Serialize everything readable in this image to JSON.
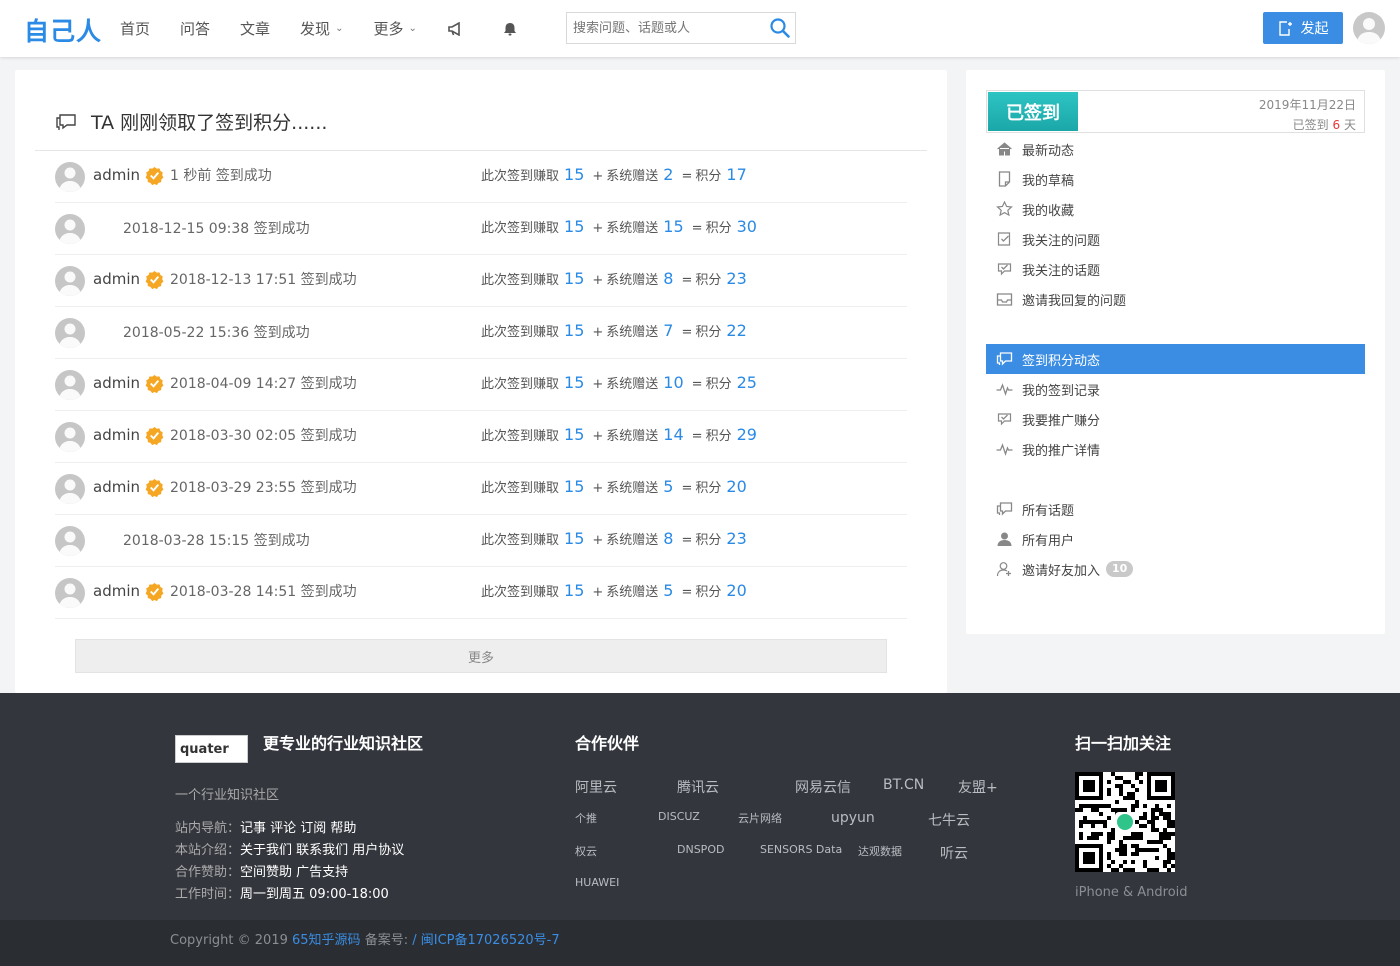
{
  "header": {
    "logo": "自己人",
    "nav": [
      {
        "label": "首页"
      },
      {
        "label": "问答"
      },
      {
        "label": "文章"
      },
      {
        "label": "发现",
        "dropdown": true
      },
      {
        "label": "更多",
        "dropdown": true
      }
    ],
    "nav_icons": [
      "megaphone-icon",
      "bell-icon"
    ],
    "search": {
      "placeholder": "搜索问题、话题或人"
    },
    "post_button": "发起"
  },
  "main": {
    "title": "TA 刚刚领取了签到积分......",
    "calc_labels": {
      "earned": "此次签到赚取",
      "plus": "+",
      "bonus": "系统赠送",
      "equals": "=",
      "total": "积分"
    },
    "rows": [
      {
        "user": "admin",
        "verified": true,
        "time": "1 秒前 签到成功",
        "earned": "15",
        "bonus": "2",
        "total": "17"
      },
      {
        "user": "",
        "verified": false,
        "time": "2018-12-15 09:38 签到成功",
        "earned": "15",
        "bonus": "15",
        "total": "30"
      },
      {
        "user": "admin",
        "verified": true,
        "time": "2018-12-13 17:51 签到成功",
        "earned": "15",
        "bonus": "8",
        "total": "23"
      },
      {
        "user": "",
        "verified": false,
        "time": "2018-05-22 15:36 签到成功",
        "earned": "15",
        "bonus": "7",
        "total": "22"
      },
      {
        "user": "admin",
        "verified": true,
        "time": "2018-04-09 14:27 签到成功",
        "earned": "15",
        "bonus": "10",
        "total": "25"
      },
      {
        "user": "admin",
        "verified": true,
        "time": "2018-03-30 02:05 签到成功",
        "earned": "15",
        "bonus": "14",
        "total": "29"
      },
      {
        "user": "admin",
        "verified": true,
        "time": "2018-03-29 23:55 签到成功",
        "earned": "15",
        "bonus": "5",
        "total": "20"
      },
      {
        "user": "",
        "verified": false,
        "time": "2018-03-28 15:15 签到成功",
        "earned": "15",
        "bonus": "8",
        "total": "23"
      },
      {
        "user": "admin",
        "verified": true,
        "time": "2018-03-28 14:51 签到成功",
        "earned": "15",
        "bonus": "5",
        "total": "20"
      }
    ],
    "more_label": "更多"
  },
  "sidebar": {
    "checkin": {
      "status": "已签到",
      "date": "2019年11月22日",
      "streak_prefix": "已签到",
      "streak_days": "6",
      "streak_suffix": "天"
    },
    "group1": [
      {
        "label": "最新动态",
        "icon": "home-icon"
      },
      {
        "label": "我的草稿",
        "icon": "draft-icon"
      },
      {
        "label": "我的收藏",
        "icon": "star-icon"
      },
      {
        "label": "我关注的问题",
        "icon": "check-doc-icon"
      },
      {
        "label": "我关注的话题",
        "icon": "check-tag-icon"
      },
      {
        "label": "邀请我回复的问题",
        "icon": "inbox-icon"
      }
    ],
    "group2": [
      {
        "label": "签到积分动态",
        "icon": "chat-icon",
        "active": true
      },
      {
        "label": "我的签到记录",
        "icon": "pulse-icon"
      },
      {
        "label": "我要推广赚分",
        "icon": "check-tag-icon"
      },
      {
        "label": "我的推广详情",
        "icon": "pulse-icon"
      }
    ],
    "group3": [
      {
        "label": "所有话题",
        "icon": "chat-icon"
      },
      {
        "label": "所有用户",
        "icon": "user-icon"
      },
      {
        "label": "邀请好友加入",
        "icon": "add-user-icon",
        "count": "10"
      }
    ]
  },
  "footer": {
    "logo_alt": "quater",
    "slogan": "更专业的行业知识社区",
    "desc": "一个行业知识社区",
    "nav_label": "站内导航：",
    "nav_links": "记事 评论 订阅 帮助",
    "about_label": "本站介绍：",
    "about_links": "关于我们 联系我们 用户协议",
    "sponsor_label": "合作赞助：",
    "sponsor_links": "空间赞助 广告支持",
    "hours_label": "工作时间：",
    "hours_value": "周一到周五 09:00-18:00",
    "partners_title": "合作伙伴",
    "partners": [
      "阿里云",
      "腾讯云",
      "网易云信",
      "BT.CN",
      "友盟+",
      "个推",
      "DISCUZ",
      "云片网络",
      "upyun",
      "七牛云",
      "权云",
      "DNSPOD",
      "SENSORS Data",
      "达观数据",
      "听云",
      "HUAWEI"
    ],
    "qr_title": "扫一扫加关注",
    "qr_caption": "iPhone & Android"
  },
  "copyright": {
    "prefix": "Copyright © 2019",
    "site": "65知乎源码",
    "icp_label": "备案号:",
    "icp": "/ 闽ICP备17026520号-7"
  }
}
